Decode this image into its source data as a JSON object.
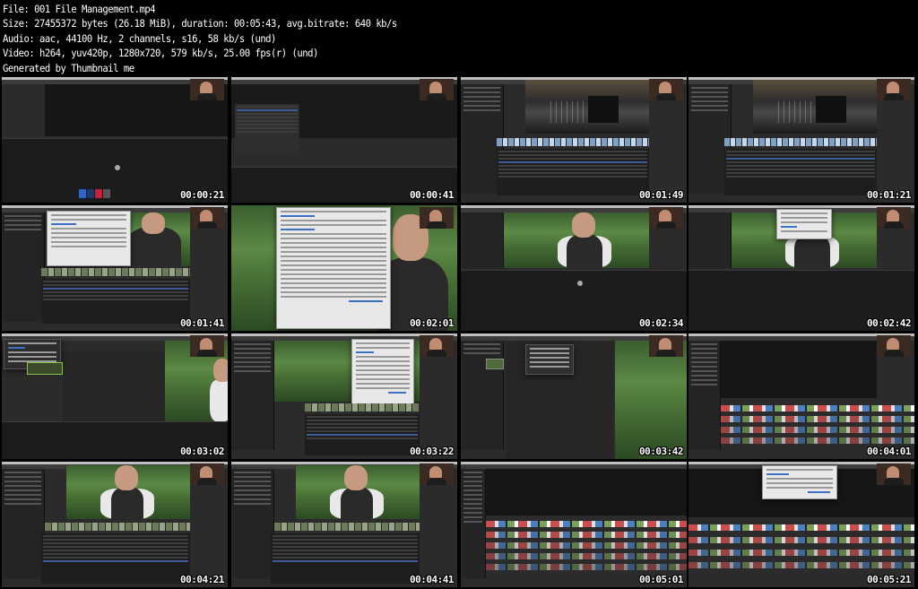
{
  "header": {
    "lines": [
      "File: 001 File Management.mp4",
      "Size: 27455372 bytes (26.18 MiB), duration: 00:05:43, avg.bitrate: 640 kb/s",
      "Audio: aac, 44100 Hz, 2 channels, s16, 58 kb/s (und)",
      "Video: h264, yuv420p, 1280x720, 579 kb/s, 25.00 fps(r) (und)",
      "Generated by Thumbnail me"
    ]
  },
  "thumbnails": [
    {
      "time": "00:00:21",
      "scene": "empty-project"
    },
    {
      "time": "00:00:41",
      "scene": "import-window"
    },
    {
      "time": "00:01:49",
      "scene": "stage-browser"
    },
    {
      "time": "00:01:21",
      "scene": "stage-browser"
    },
    {
      "time": "00:01:41",
      "scene": "import-options-person"
    },
    {
      "time": "00:02:01",
      "scene": "media-import-dialog"
    },
    {
      "time": "00:02:34",
      "scene": "person-viewer"
    },
    {
      "time": "00:02:42",
      "scene": "person-viewer-popup"
    },
    {
      "time": "00:03:02",
      "scene": "menu-nature"
    },
    {
      "time": "00:03:22",
      "scene": "import-options-browser"
    },
    {
      "time": "00:03:42",
      "scene": "event-nature"
    },
    {
      "time": "00:04:01",
      "scene": "timeline-filmstrips"
    },
    {
      "time": "00:04:21",
      "scene": "person-browser"
    },
    {
      "time": "00:04:41",
      "scene": "person-browser"
    },
    {
      "time": "00:05:01",
      "scene": "timeline-dense"
    },
    {
      "time": "00:05:21",
      "scene": "timeline-dialog"
    }
  ],
  "colors": {
    "background": "#000000",
    "text": "#ffffff",
    "app_panel": "#2b2b2b",
    "selection": "#3b5d96"
  }
}
